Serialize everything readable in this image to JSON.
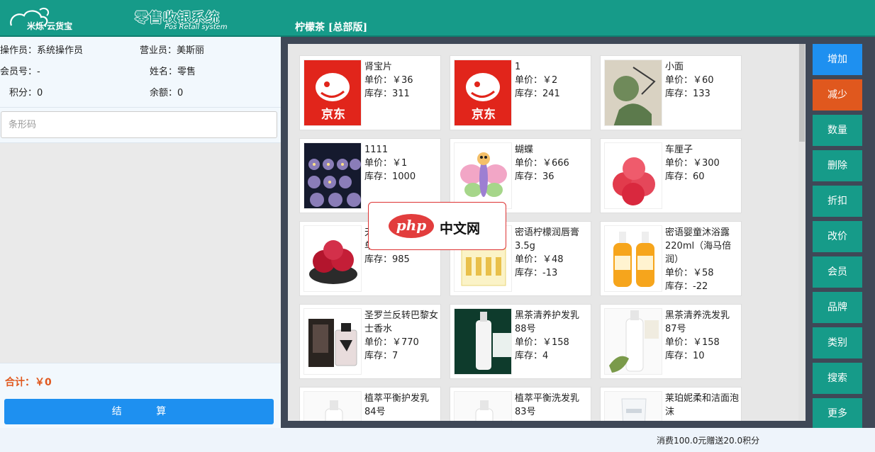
{
  "header": {
    "logo_text": "米烁·云货宝",
    "system_title": "零售收银系统",
    "system_subtitle": "Pos Retail system",
    "store_name": "柠檬茶  [总部版]"
  },
  "info": {
    "operator": "操作员：系统操作员",
    "clerk": "营业员：美斯丽",
    "member_no": "会员号：-",
    "name": "姓名：零售",
    "points": "积分：0",
    "balance": "余额：0"
  },
  "barcode": {
    "placeholder": "条形码",
    "value": ""
  },
  "summary": {
    "total": "合计：￥0",
    "checkout_label": "结 算"
  },
  "products": [
    {
      "name": "肾宝片",
      "price": "单价：￥36",
      "stock": "库存：311",
      "image": "jd-logo"
    },
    {
      "name": "1",
      "price": "单价：￥2",
      "stock": "库存：241",
      "image": "jd-logo"
    },
    {
      "name": "小面",
      "price": "单价：￥60",
      "stock": "库存：133",
      "image": "art-painting"
    },
    {
      "name": "1111",
      "price": "单价：￥1",
      "stock": "库存：1000",
      "image": "candles"
    },
    {
      "name": "蝴蝶",
      "price": "单价：￥666",
      "stock": "库存：36",
      "image": "butterfly"
    },
    {
      "name": "车厘子",
      "price": "单价：￥300",
      "stock": "库存：60",
      "image": "apples"
    },
    {
      "name": "天",
      "price": "单",
      "stock": "库存：985",
      "image": "red-fruit"
    },
    {
      "name": "密语柠檬润唇膏3.5g",
      "price": "单价：￥48",
      "stock": "库存：-13",
      "image": "lip-balm"
    },
    {
      "name": "密语婴童沐浴露220ml（海马倍润）",
      "price": "单价：￥58",
      "stock": "库存：-22",
      "image": "bottles"
    },
    {
      "name": "圣罗兰反转巴黎女士香水",
      "price": "单价：￥770",
      "stock": "库存：7",
      "image": "perfume"
    },
    {
      "name": "黑茶清养护发乳88号",
      "price": "单价：￥158",
      "stock": "库存：4",
      "image": "green-bottle"
    },
    {
      "name": "黑茶清养洗发乳87号",
      "price": "单价：￥158",
      "stock": "库存：10",
      "image": "white-bottle"
    },
    {
      "name": "植萃平衡护发乳84号",
      "price": "",
      "stock": "",
      "image": "white-bottle-small"
    },
    {
      "name": "植萃平衡洗发乳83号",
      "price": "",
      "stock": "",
      "image": "white-bottle-small"
    },
    {
      "name": "莱珀妮柔和洁面泡沫",
      "price": "",
      "stock": "",
      "image": "tube"
    }
  ],
  "actions": [
    {
      "label": "增加",
      "color": "#1e90f0"
    },
    {
      "label": "减少",
      "color": "#e0581e"
    },
    {
      "label": "数量",
      "color": "#169b89"
    },
    {
      "label": "删除",
      "color": "#169b89"
    },
    {
      "label": "折扣",
      "color": "#169b89"
    },
    {
      "label": "改价",
      "color": "#169b89"
    },
    {
      "label": "会员",
      "color": "#169b89"
    },
    {
      "label": "品牌",
      "color": "#169b89"
    },
    {
      "label": "类别",
      "color": "#169b89"
    },
    {
      "label": "搜索",
      "color": "#169b89"
    },
    {
      "label": "更多",
      "color": "#169b89"
    }
  ],
  "watermark": {
    "logo": "php",
    "text": "中文网"
  },
  "footer": {
    "promo": "消费100.0元赠送20.0积分"
  }
}
